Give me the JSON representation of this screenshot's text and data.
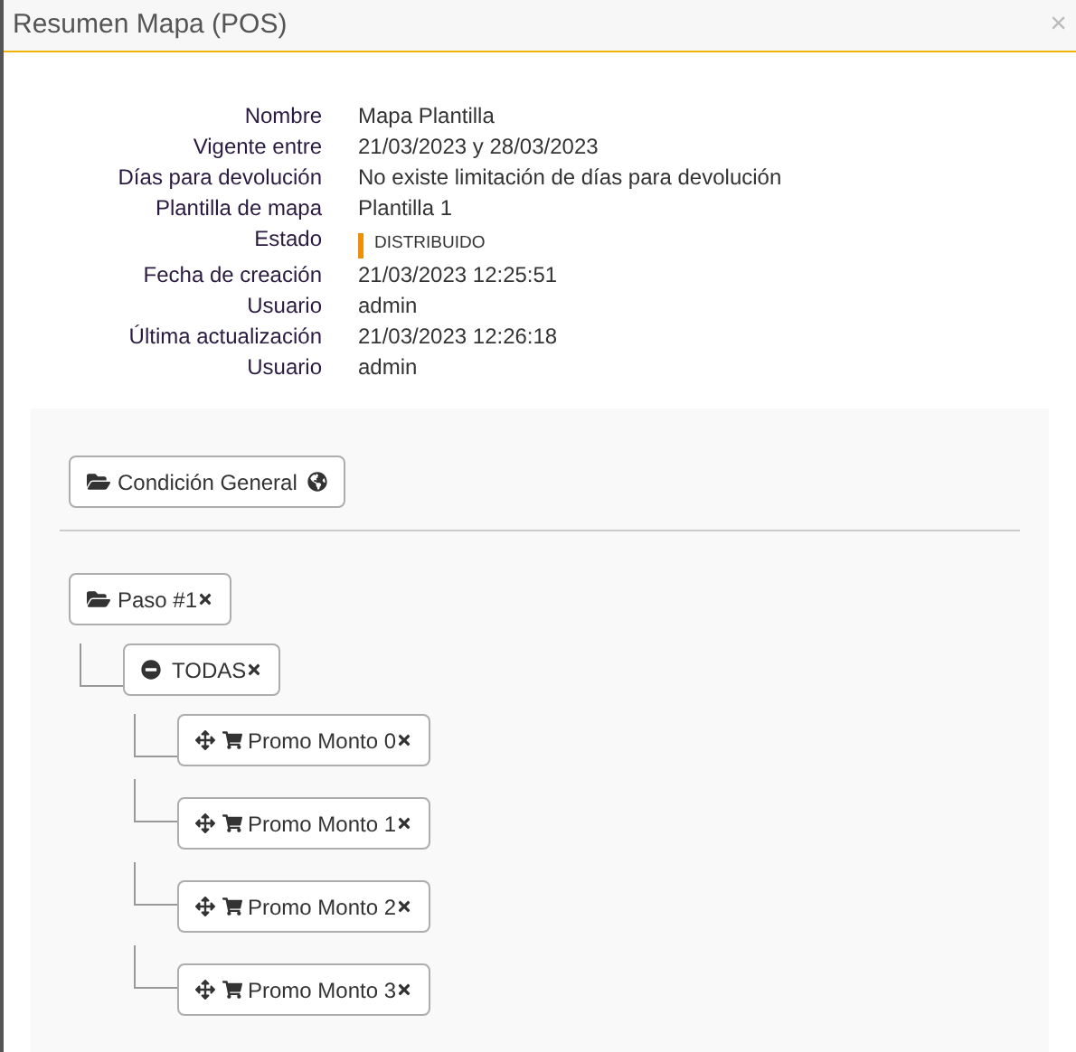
{
  "window": {
    "title": "Resumen Mapa (POS)",
    "close": "×"
  },
  "details": [
    {
      "label": "Nombre",
      "value": "Mapa Plantilla"
    },
    {
      "label": "Vigente entre",
      "value": "21/03/2023 y 28/03/2023"
    },
    {
      "label": "Días para devolución",
      "value": "No existe limitación de días para devolución"
    },
    {
      "label": "Plantilla de mapa",
      "value": "Plantilla 1"
    },
    {
      "label": "Estado",
      "value": "DISTRIBUIDO",
      "kind": "status",
      "color": "#f0900a"
    },
    {
      "label": "Fecha de creación",
      "value": "21/03/2023 12:25:51"
    },
    {
      "label": "Usuario",
      "value": "admin"
    },
    {
      "label": "Última actualización",
      "value": "21/03/2023 12:26:18"
    },
    {
      "label": "Usuario",
      "value": "admin"
    }
  ],
  "general_condition": {
    "label": "Condición General"
  },
  "tree": [
    {
      "kind": "step",
      "label": "Paso #1",
      "children": [
        {
          "kind": "group",
          "label": "TODAS",
          "children": [
            {
              "kind": "promo",
              "label": "Promo Monto 0"
            },
            {
              "kind": "promo",
              "label": "Promo Monto 1"
            },
            {
              "kind": "promo",
              "label": "Promo Monto 2"
            },
            {
              "kind": "promo",
              "label": "Promo Monto 3"
            }
          ]
        }
      ]
    }
  ]
}
